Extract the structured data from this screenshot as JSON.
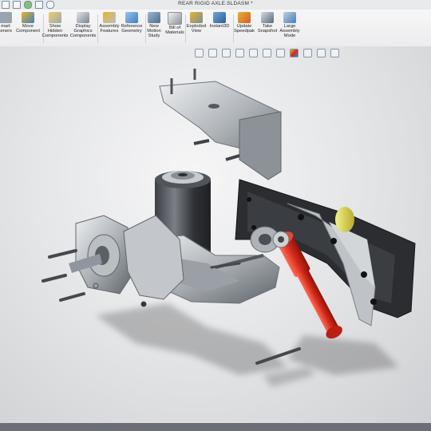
{
  "window": {
    "document_title": "REAR RIGID AXLE.SLDASM *"
  },
  "ribbon": {
    "buttons": [
      {
        "id": "smart-fasteners",
        "label": "mart\nteners",
        "icon": "smart-fasteners-icon"
      },
      {
        "id": "move-component",
        "label": "Move\nComponent",
        "icon": "move-component-icon"
      },
      {
        "id": "show-hidden-components",
        "label": "Show\nHidden\nComponents",
        "icon": "show-hidden-icon"
      },
      {
        "id": "display-graphics-components",
        "label": "Display\nGraphics\nComponents",
        "icon": "display-graphics-icon"
      },
      {
        "id": "assembly-features",
        "label": "Assembly\nFeatures",
        "icon": "assembly-features-icon"
      },
      {
        "id": "reference-geometry",
        "label": "Reference\nGeometry",
        "icon": "reference-geometry-icon"
      },
      {
        "id": "new-motion-study",
        "label": "New\nMotion\nStudy",
        "icon": "motion-study-icon"
      },
      {
        "id": "bill-of-materials",
        "label": "Bill of\nMaterials",
        "icon": "bill-of-materials-icon"
      },
      {
        "id": "exploded-view",
        "label": "Exploded\nView",
        "icon": "exploded-view-icon"
      },
      {
        "id": "instant3d",
        "label": "Instant3D",
        "icon": "instant3d-icon"
      },
      {
        "id": "update-speedpak",
        "label": "Update\nSpeedpak",
        "icon": "speedpak-icon"
      },
      {
        "id": "take-snapshot",
        "label": "Take\nSnapshot",
        "icon": "snapshot-icon"
      },
      {
        "id": "large-assembly-mode",
        "label": "Large\nAssembly\nMode",
        "icon": "large-assembly-icon"
      }
    ]
  },
  "colors": {
    "accent_red": "#d42a1c",
    "bracket_black": "#2b2d31",
    "metal_light": "#c9ccd0",
    "metal_dark": "#6e7277",
    "ribbon_icon_blue": "#3d7fc6",
    "ribbon_icon_yellow": "#e6b42b"
  }
}
